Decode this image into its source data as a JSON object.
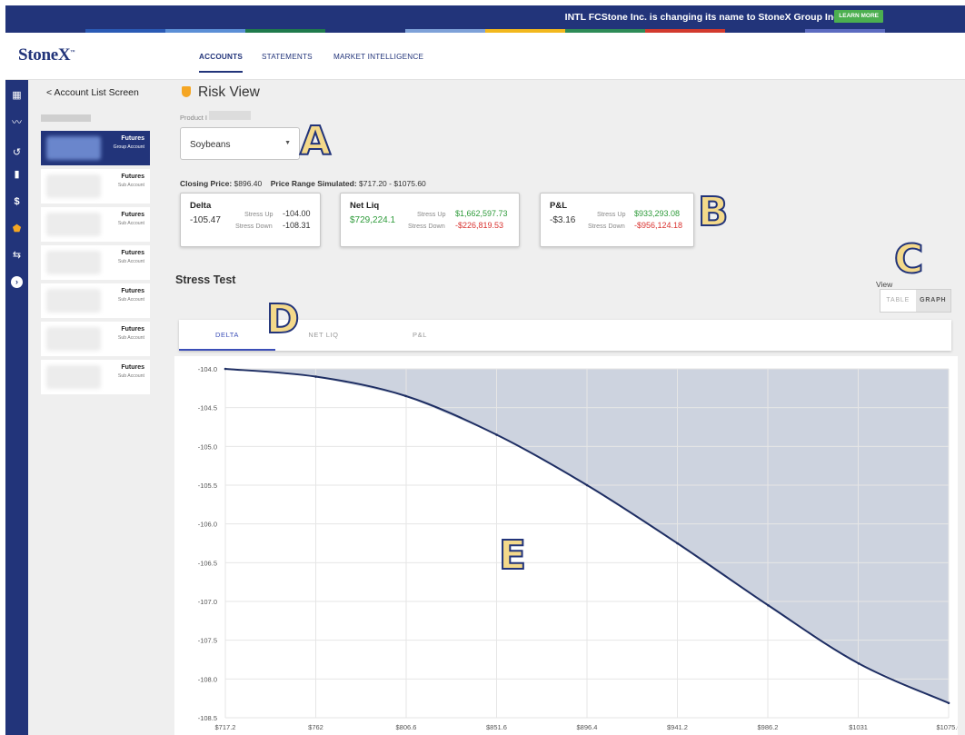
{
  "banner": {
    "text": "INTL FCStone Inc. is changing its name to StoneX Group Inc.",
    "button": "LEARN MORE",
    "stripe_colors": [
      "#22347a",
      "#2a5ab5",
      "#5b8fd6",
      "#1f7a4c",
      "#22347a",
      "#7ea1d8",
      "#f2b81d",
      "#2e8b57",
      "#d23a2e",
      "#22347a",
      "#5c6bc0",
      "#22347a"
    ]
  },
  "nav": {
    "logo": "StoneX",
    "logo_tm": "™",
    "tabs": [
      "ACCOUNTS",
      "STATEMENTS",
      "MARKET INTELLIGENCE"
    ]
  },
  "rail": {
    "icons": [
      "dashboard-icon",
      "trend-icon",
      "history-icon",
      "bar-chart-icon",
      "dollar-icon",
      "shield-icon",
      "transfer-icon",
      "chevron-right-icon"
    ],
    "glyphs": [
      "▦",
      "〰",
      "↺",
      "▮",
      "$",
      "⬟",
      "⇆",
      "›"
    ]
  },
  "account_list": {
    "back": "< Account List Screen",
    "accounts": [
      {
        "type": "Futures",
        "sub": "Group Account",
        "selected": true
      },
      {
        "type": "Futures",
        "sub": "Sub Account",
        "selected": false
      },
      {
        "type": "Futures",
        "sub": "Sub Account",
        "selected": false
      },
      {
        "type": "Futures",
        "sub": "Sub Account",
        "selected": false
      },
      {
        "type": "Futures",
        "sub": "Sub Account",
        "selected": false
      },
      {
        "type": "Futures",
        "sub": "Sub Account",
        "selected": false
      },
      {
        "type": "Futures",
        "sub": "Sub Account",
        "selected": false
      }
    ]
  },
  "risk": {
    "title": "Risk View",
    "product_label": "Product I",
    "product_value": "Soybeans",
    "closing_label": "Closing Price:",
    "closing_value": "$896.40",
    "range_label": "Price Range Simulated:",
    "range_value": "$717.20 - $1075.60",
    "cards": {
      "delta": {
        "title": "Delta",
        "value": "-105.47",
        "stress_up_label": "Stress Up",
        "stress_up": "-104.00",
        "stress_down_label": "Stress Down",
        "stress_down": "-108.31"
      },
      "netliq": {
        "title": "Net Liq",
        "value": "$729,224.1",
        "stress_up_label": "Stress Up",
        "stress_up": "$1,662,597.73",
        "stress_down_label": "Stress Down",
        "stress_down": "-$226,819.53"
      },
      "pnl": {
        "title": "P&L",
        "value": "-$3.16",
        "stress_up_label": "Stress Up",
        "stress_up": "$933,293.08",
        "stress_down_label": "Stress Down",
        "stress_down": "-$956,124.18"
      }
    }
  },
  "stress": {
    "title": "Stress Test",
    "view_label": "View",
    "view_options": [
      "TABLE",
      "GRAPH"
    ],
    "view_selected": "GRAPH",
    "tabs": [
      "DELTA",
      "NET LIQ",
      "P&L"
    ],
    "active_tab": "DELTA"
  },
  "callouts": [
    "A",
    "B",
    "C",
    "D",
    "E"
  ],
  "colors": {
    "brand": "#22347a",
    "accent": "#3b4eb7",
    "fill": "#cdd3df",
    "line": "#1e2e63",
    "green": "#2e9b3a",
    "red": "#d9322f",
    "shield": "#f5a623"
  },
  "chart_data": {
    "type": "area",
    "title": "",
    "xlabel": "",
    "ylabel": "",
    "x_ticks": [
      "$717.2",
      "$762",
      "$806.6",
      "$851.6",
      "$896.4",
      "$941.2",
      "$986.2",
      "$1031",
      "$1075.6"
    ],
    "y_ticks": [
      "-104.0",
      "-104.5",
      "-105.0",
      "-105.5",
      "-106.0",
      "-106.5",
      "-107.0",
      "-107.5",
      "-108.0",
      "-108.5"
    ],
    "ylim": [
      -108.5,
      -104.0
    ],
    "xlim": [
      717.2,
      1075.6
    ],
    "grid": true,
    "series": [
      {
        "x": [
          717.2,
          762,
          806.6,
          851.6,
          896.4,
          941.2,
          986.2,
          1031,
          1075.6
        ],
        "values": [
          -104.0,
          -104.1,
          -104.35,
          -104.85,
          -105.5,
          -106.25,
          -107.05,
          -107.8,
          -108.31
        ]
      }
    ]
  }
}
